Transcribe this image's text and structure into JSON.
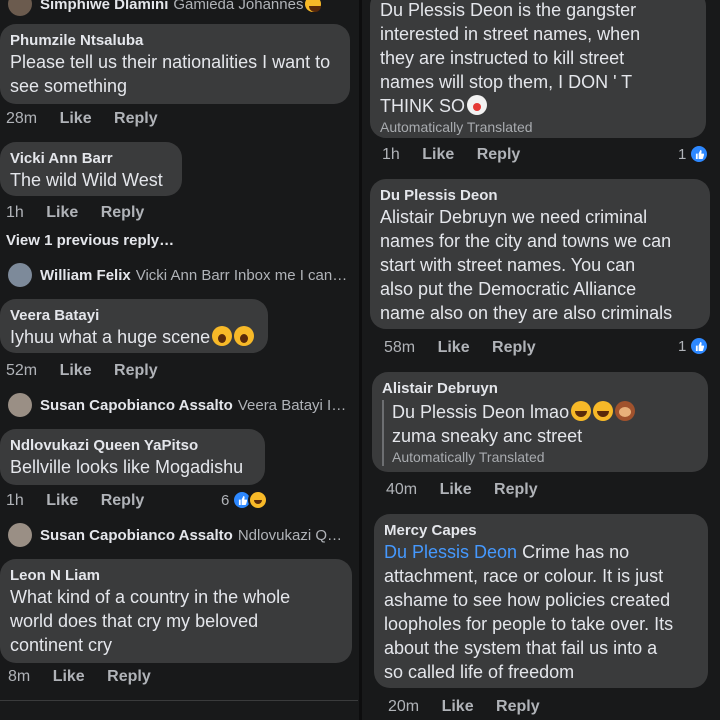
{
  "left": {
    "top_reply": {
      "name": "Simphiwe Dlamini",
      "text": "Gamieda Johannes"
    },
    "c1": {
      "author": "Phumzile Ntsaluba",
      "line1": "Please tell us their nationalities I want to",
      "line2": "see something",
      "time": "28m",
      "like": "Like",
      "reply": "Reply"
    },
    "c2": {
      "author": "Vicki Ann Barr",
      "line1": "The wild Wild West",
      "time": "1h",
      "like": "Like",
      "reply": "Reply"
    },
    "view_prev": "View 1 previous reply…",
    "r1": {
      "name": "William Felix",
      "text": "Vicki Ann Barr Inbox me I can t…"
    },
    "c3": {
      "author": "Veera Batayi",
      "line1": "Iyhuu what a huge scene",
      "time": "52m",
      "like": "Like",
      "reply": "Reply"
    },
    "r2": {
      "name": "Susan Capobianco Assalto",
      "text": "Veera Batayi If …"
    },
    "c4": {
      "author": "Ndlovukazi Queen YaPitso",
      "line1": "Bellville looks like Mogadishu",
      "time": "1h",
      "like": "Like",
      "reply": "Reply",
      "reactions": "6"
    },
    "r3": {
      "name": "Susan Capobianco Assalto",
      "text": "Ndlovukazi Que…"
    },
    "c5": {
      "author": "Leon N Liam",
      "line1": "What kind of  a country in the whole",
      "line2": "world does that cry my beloved",
      "line3": "continent cry",
      "time": "8m",
      "like": "Like",
      "reply": "Reply"
    }
  },
  "right": {
    "c1": {
      "line1": "Du Plessis Deon is the gangster",
      "line2": "interested in street names, when",
      "line3": "they are instructed to kill street",
      "line4": "names will stop them, I DON ' T",
      "line5": "THINK SO",
      "translated": "Automatically Translated",
      "time": "1h",
      "like": "Like",
      "reply": "Reply",
      "reactions": "1"
    },
    "c2": {
      "author": "Du Plessis Deon",
      "line1": "Alistair Debruyn we need criminal",
      "line2": "names for the city and towns we can",
      "line3": "start with street names. You can",
      "line4": "also put the Democratic Alliance",
      "line5": "name also on they are also criminals",
      "time": "58m",
      "like": "Like",
      "reply": "Reply",
      "reactions": "1"
    },
    "c3": {
      "author": "Alistair Debruyn",
      "line1": "Du Plessis Deon lmao",
      "line2": "zuma sneaky anc street",
      "translated": "Automatically Translated",
      "time": "40m",
      "like": "Like",
      "reply": "Reply"
    },
    "c4": {
      "author": "Mercy Capes",
      "mention": "Du Plessis Deon",
      "line1": " Crime has no",
      "line2": "attachment, race or colour. It is just",
      "line3": "ashame to see how policies created",
      "line4": "loopholes for people to take over. Its",
      "line5": "about the system that fail us into a",
      "line6": "so called life of freedom",
      "time": "20m",
      "like": "Like",
      "reply": "Reply"
    }
  },
  "colors": {
    "bubble": "#3a3b3c",
    "background": "#18191a",
    "link": "#4599ff",
    "like_blue": "#2d88ff"
  }
}
